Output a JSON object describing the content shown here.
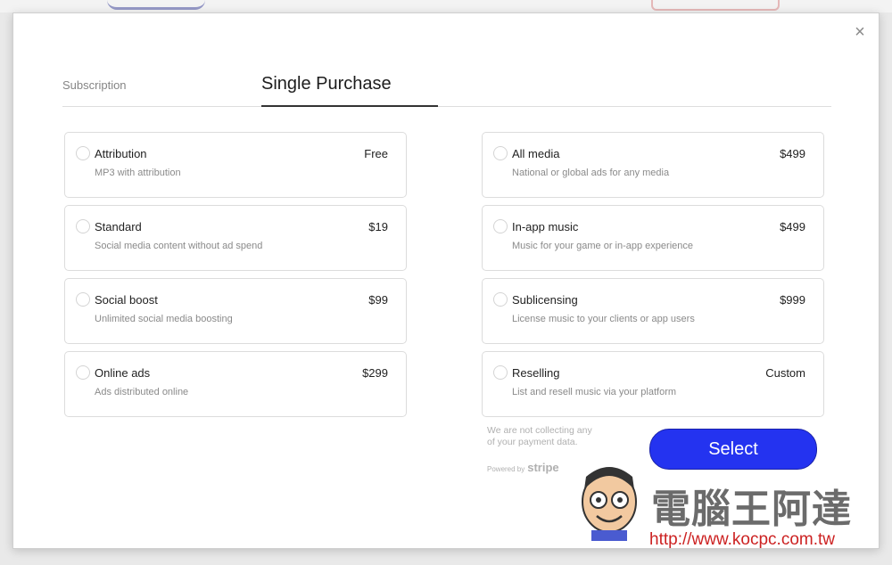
{
  "tabs": {
    "subscription": "Subscription",
    "single_purchase": "Single Purchase",
    "active": "single_purchase"
  },
  "close_glyph": "×",
  "options_left": [
    {
      "title": "Attribution",
      "desc": "MP3 with attribution",
      "price": "Free"
    },
    {
      "title": "Standard",
      "desc": "Social media content without ad spend",
      "price": "$19"
    },
    {
      "title": "Social boost",
      "desc": "Unlimited social media boosting",
      "price": "$99"
    },
    {
      "title": "Online ads",
      "desc": "Ads distributed online",
      "price": "$299"
    }
  ],
  "options_right": [
    {
      "title": "All media",
      "desc": "National or global ads for any media",
      "price": "$499"
    },
    {
      "title": "In-app music",
      "desc": "Music for your game or in-app experience",
      "price": "$499"
    },
    {
      "title": "Sublicensing",
      "desc": "License music to your clients or app users",
      "price": "$999"
    },
    {
      "title": "Reselling",
      "desc": "List and resell music via your platform",
      "price": "Custom"
    }
  ],
  "payment_note": "We are not collecting any of your payment data.",
  "powered_by": "Powered by",
  "stripe": "stripe",
  "select_label": "Select",
  "watermark": {
    "title": "電腦王阿達",
    "url": "http://www.kocpc.com.tw"
  },
  "colors": {
    "accent": "#2433f0",
    "watermark_url": "#cc2222"
  }
}
